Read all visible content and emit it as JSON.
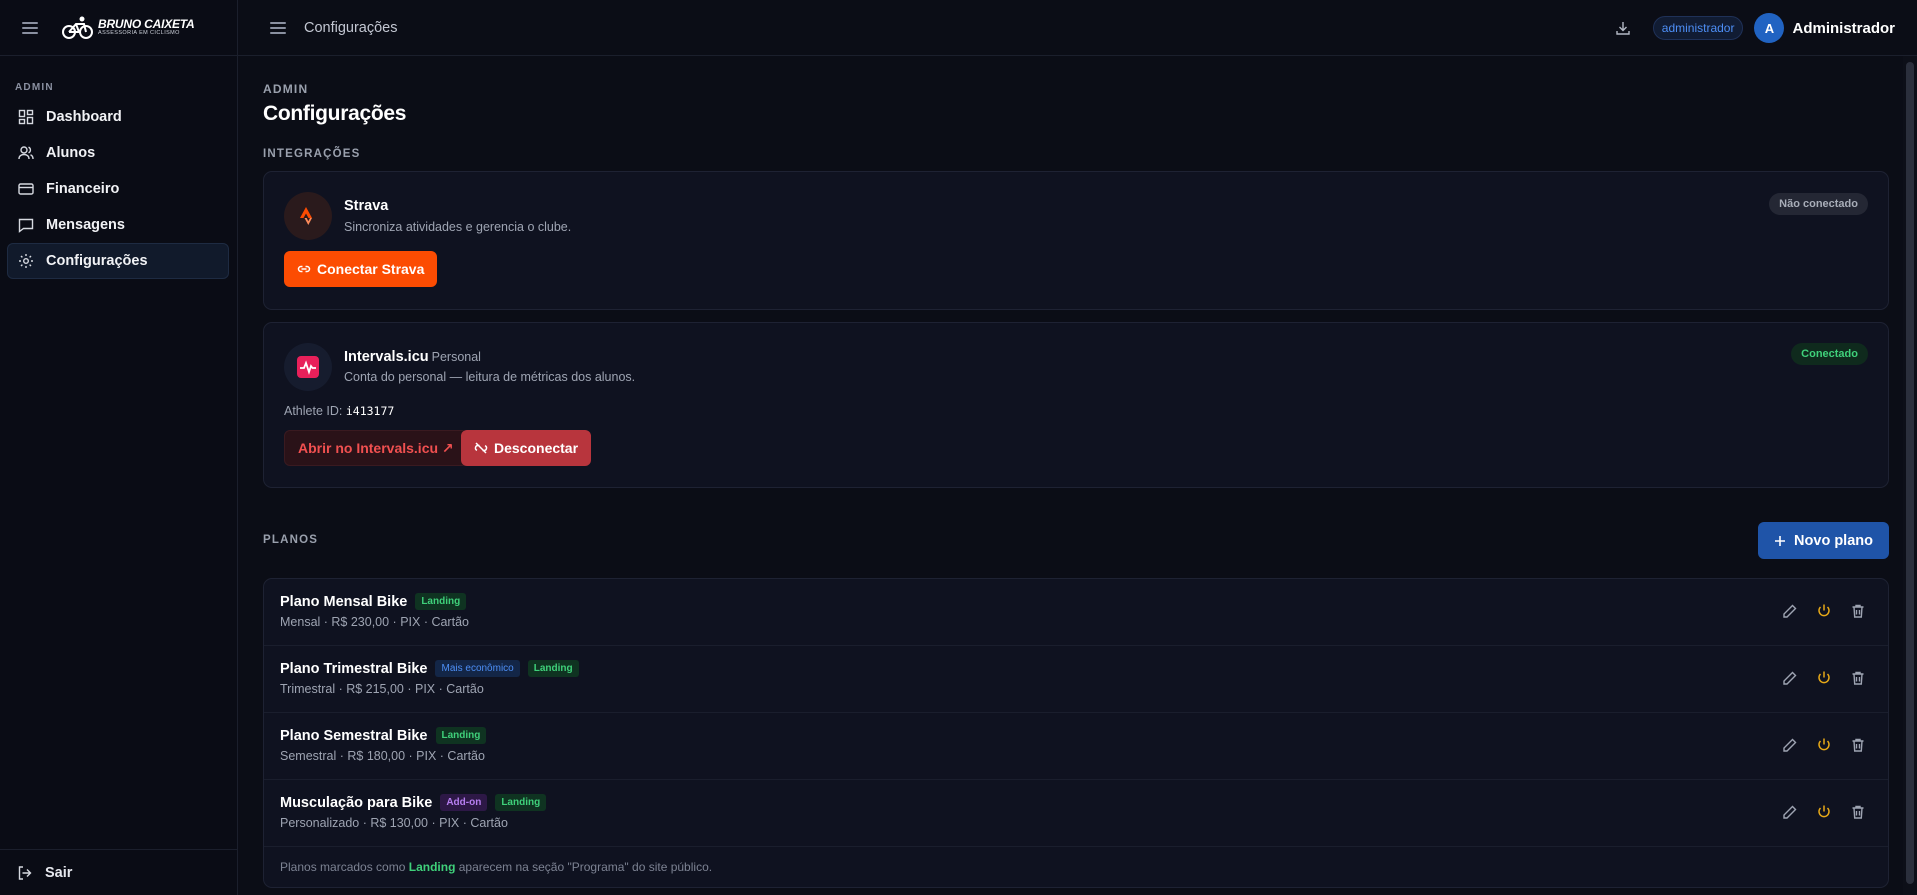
{
  "brand": {
    "name": "BRUNO CAIXETA",
    "tagline": "ASSESSORIA EM CICLISMO"
  },
  "sidebar": {
    "section": "ADMIN",
    "items": [
      {
        "label": "Dashboard",
        "icon": "dashboard-icon"
      },
      {
        "label": "Alunos",
        "icon": "users-icon"
      },
      {
        "label": "Financeiro",
        "icon": "credit-card-icon"
      },
      {
        "label": "Mensagens",
        "icon": "message-icon"
      },
      {
        "label": "Configurações",
        "icon": "gear-icon",
        "active": true
      }
    ],
    "logout": "Sair"
  },
  "topbar": {
    "title": "Configurações",
    "role": "administrador",
    "avatar_initial": "A",
    "user_name": "Administrador"
  },
  "page": {
    "eyebrow": "ADMIN",
    "title": "Configurações"
  },
  "integrations": {
    "section": "INTEGRAÇÕES",
    "strava": {
      "name": "Strava",
      "description": "Sincroniza atividades e gerencia o clube.",
      "status": "Não conectado",
      "connect_label": "Conectar Strava"
    },
    "intervals": {
      "name": "Intervals.icu",
      "tag": "Personal",
      "description": "Conta do personal — leitura de métricas dos alunos.",
      "status": "Conectado",
      "athlete_label": "Athlete ID:",
      "athlete_id": "i413177",
      "open_label": "Abrir no Intervals.icu ↗",
      "disconnect_label": "Desconectar"
    }
  },
  "plans": {
    "section": "PLANOS",
    "new_label": "Novo plano",
    "items": [
      {
        "name": "Plano Mensal Bike",
        "badges": [
          "Landing"
        ],
        "detail": "Mensal · R$ 230,00 · PIX · Cartão"
      },
      {
        "name": "Plano Trimestral Bike",
        "badges": [
          "Mais econômico",
          "Landing"
        ],
        "detail": "Trimestral · R$ 215,00 · PIX · Cartão"
      },
      {
        "name": "Plano Semestral Bike",
        "badges": [
          "Landing"
        ],
        "detail": "Semestral · R$ 180,00 · PIX · Cartão"
      },
      {
        "name": "Musculação para Bike",
        "badges": [
          "Add-on",
          "Landing"
        ],
        "detail": "Personalizado · R$ 130,00 · PIX · Cartão"
      }
    ],
    "footnote_pre": "Planos marcados como",
    "footnote_highlight": "Landing",
    "footnote_post": "aparecem na seção \"Programa\" do site público."
  },
  "colors": {
    "strava_orange": "#fc4c02",
    "primary_blue": "#1f54a8",
    "danger_red": "#b8353d",
    "success_green": "#3fd07a",
    "warning_amber": "#e6a817"
  }
}
